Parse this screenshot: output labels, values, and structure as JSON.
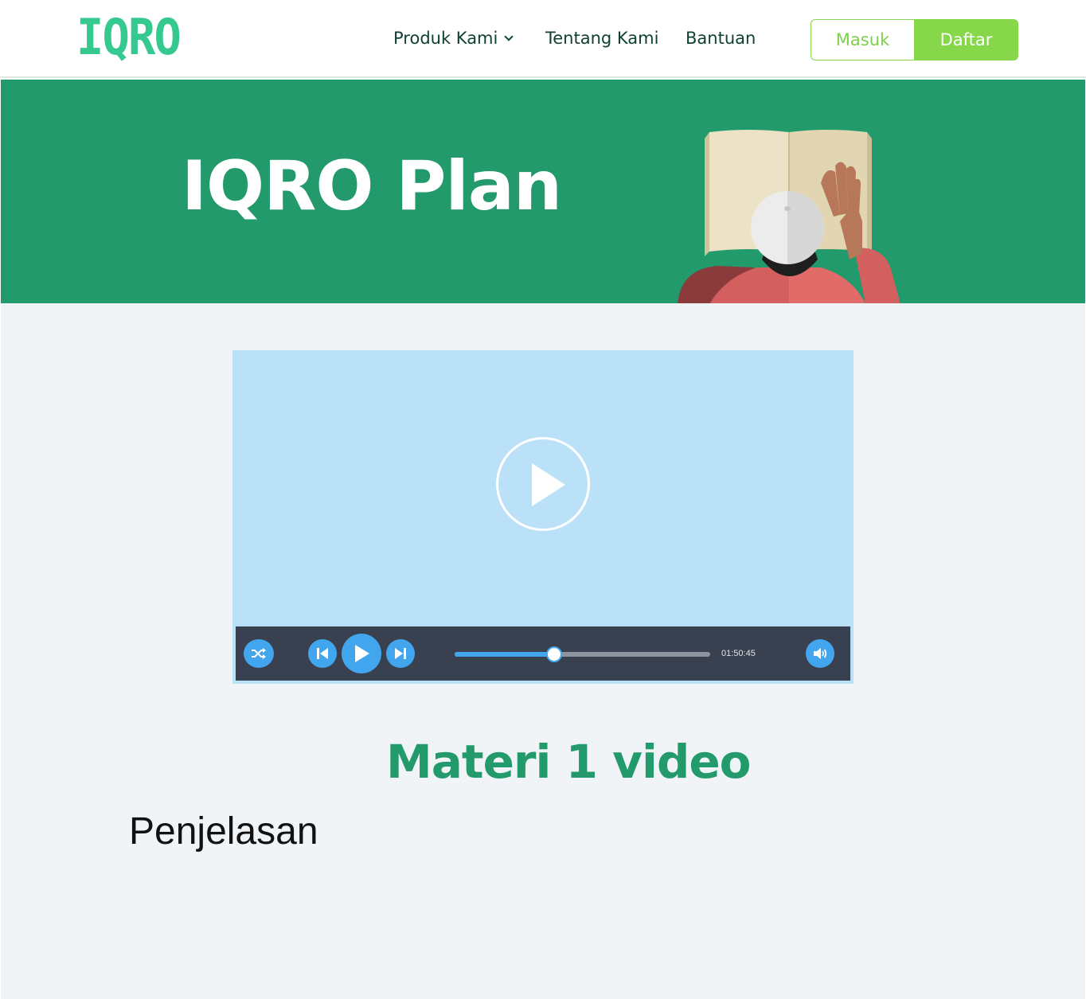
{
  "header": {
    "logo_text": "IQRO",
    "nav": {
      "produk_label": "Produk Kami",
      "tentang_label": "Tentang Kami",
      "bantuan_label": "Bantuan"
    },
    "masuk_label": "Masuk",
    "daftar_label": "Daftar"
  },
  "hero": {
    "title": "IQRO Plan",
    "illustration": "person-reading-book-illustration"
  },
  "video_player": {
    "big_play_icon": "play-icon",
    "icons": [
      "shuffle-icon",
      "previous-icon",
      "play-icon",
      "next-icon",
      "volume-icon"
    ],
    "progress": 0.39,
    "time": "01:50:45"
  },
  "content": {
    "title": "Materi 1 video",
    "description": "Penjelasan"
  },
  "colors": {
    "brand_green": "#229a6b",
    "logo_green": "#36c98f",
    "cta_green": "#86d84a",
    "player_blue": "#42a6ef",
    "player_bg": "#bbe1f9",
    "controls_bg": "#394150"
  }
}
